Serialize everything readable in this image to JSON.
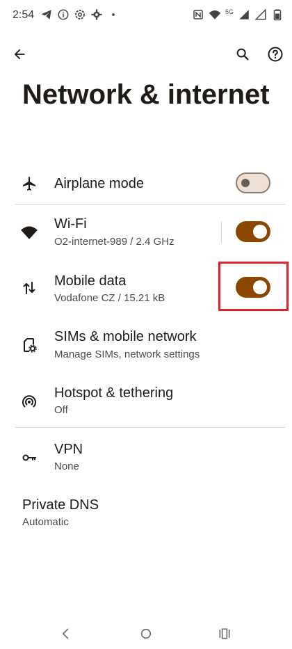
{
  "status_bar": {
    "time": "2:54",
    "network_type": "5G",
    "icons_left": [
      "telegram-icon",
      "info-icon",
      "settings-icon",
      "gear-icon",
      "dot-icon"
    ],
    "icons_right": [
      "nfc-icon",
      "wifi-icon",
      "signal-icon",
      "signal-icon",
      "battery-icon"
    ]
  },
  "header": {
    "title": "Network & internet",
    "back_icon": "arrow-back-icon",
    "search_icon": "search-icon",
    "help_icon": "help-icon"
  },
  "items": [
    {
      "id": "airplane",
      "title": "Airplane mode",
      "subtitle": "",
      "icon": "airplane-icon",
      "toggle": "off"
    },
    {
      "id": "wifi",
      "title": "Wi-Fi",
      "subtitle": "O2-internet-989 / 2.4 GHz",
      "icon": "wifi-icon",
      "toggle": "on"
    },
    {
      "id": "mobile-data",
      "title": "Mobile data",
      "subtitle": "Vodafone CZ / 15.21 kB",
      "icon": "mobile-data-icon",
      "toggle": "on"
    },
    {
      "id": "sims",
      "title": "SIMs & mobile network",
      "subtitle": "Manage SIMs, network settings",
      "icon": "sim-settings-icon"
    },
    {
      "id": "hotspot",
      "title": "Hotspot & tethering",
      "subtitle": "Off",
      "icon": "hotspot-icon"
    },
    {
      "id": "vpn",
      "title": "VPN",
      "subtitle": "None",
      "icon": "key-icon"
    },
    {
      "id": "private-dns",
      "title": "Private DNS",
      "subtitle": "Automatic"
    }
  ],
  "nav_bar": {
    "buttons": [
      "back-nav-icon",
      "home-nav-icon",
      "recents-nav-icon"
    ]
  },
  "colors": {
    "accent": "#8b4700",
    "highlight": "#e0202a",
    "background": "#ffffff",
    "text": "#1f1b16"
  }
}
